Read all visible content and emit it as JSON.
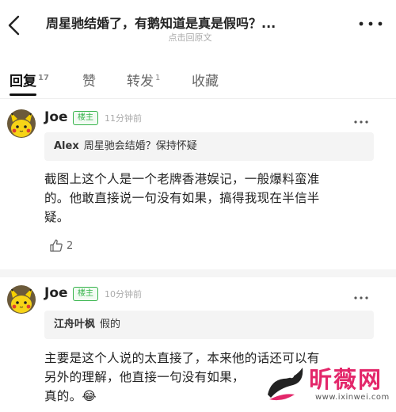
{
  "header": {
    "title": "周星驰结婚了，有鹅知道是真是假吗？...",
    "subtitle": "点击回原文"
  },
  "tabs": [
    {
      "label": "回复",
      "count": "17"
    },
    {
      "label": "赞",
      "count": ""
    },
    {
      "label": "转发",
      "count": "1"
    },
    {
      "label": "收藏",
      "count": ""
    }
  ],
  "comments": [
    {
      "author": "Joe",
      "badge": "楼主",
      "time": "11分钟前",
      "quote_name": "Alex",
      "quote_text": "周星驰会结婚？保持怀疑",
      "lines": [
        "截图上这个人是一个老牌香港娱记，一般爆料蛮准",
        "的。他敢直接说一句没有如果，搞得我现在半信半",
        "疑。"
      ],
      "likes": "2"
    },
    {
      "author": "Joe",
      "badge": "楼主",
      "time": "10分钟前",
      "quote_name": "江舟叶枫",
      "quote_text": "假的",
      "lines": [
        "主要是这个人说的太直接了，本来他的话还可以有",
        "另外的理解，他直接一句没有如果，",
        "真的。😂"
      ]
    }
  ],
  "watermark": {
    "text": "昕薇网",
    "url": "www.ixinwei.com"
  },
  "colors": {
    "badge_green": "#35b34a",
    "watermark_pink": "#e3276a"
  },
  "icons": [
    "back-arrow-icon",
    "more-icon",
    "thumbs-up-icon",
    "pikachu-avatar"
  ]
}
